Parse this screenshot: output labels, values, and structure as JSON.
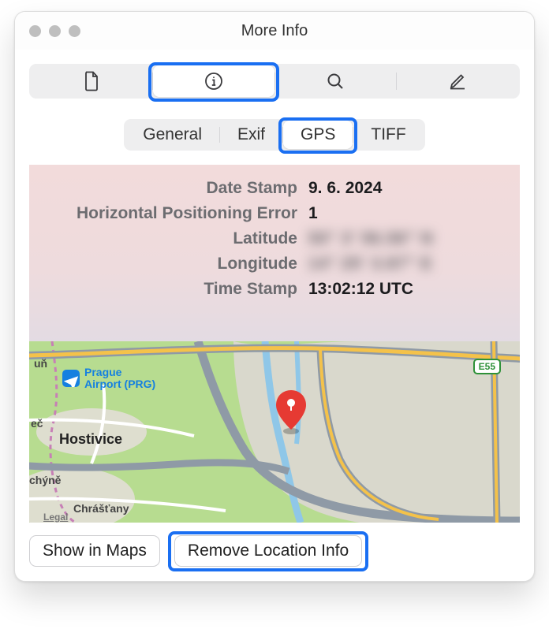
{
  "window": {
    "title": "More Info"
  },
  "subtabs": {
    "general": "General",
    "exif": "Exif",
    "gps": "GPS",
    "tiff": "TIFF"
  },
  "gps": {
    "rows": [
      {
        "label": "Date Stamp",
        "value": "9. 6. 2024",
        "blurred": false
      },
      {
        "label": "Horizontal Positioning Error",
        "value": "1",
        "blurred": false
      },
      {
        "label": "Latitude",
        "value": "50° 3' 56.56\" N",
        "blurred": true
      },
      {
        "label": "Longitude",
        "value": "14° 25' 3.87\" E",
        "blurred": true
      },
      {
        "label": "Time Stamp",
        "value": "13:02:12 UTC",
        "blurred": false
      }
    ]
  },
  "map": {
    "airport_label": "Prague\nAirport (PRG)",
    "city1": "Hostivice",
    "place1": "uň",
    "place2": "eč",
    "place3": "chýně",
    "place4": "Chrášťany",
    "road_badge": "E55",
    "legal": "Legal"
  },
  "buttons": {
    "show_in_maps": "Show in Maps",
    "remove_location": "Remove Location Info"
  }
}
